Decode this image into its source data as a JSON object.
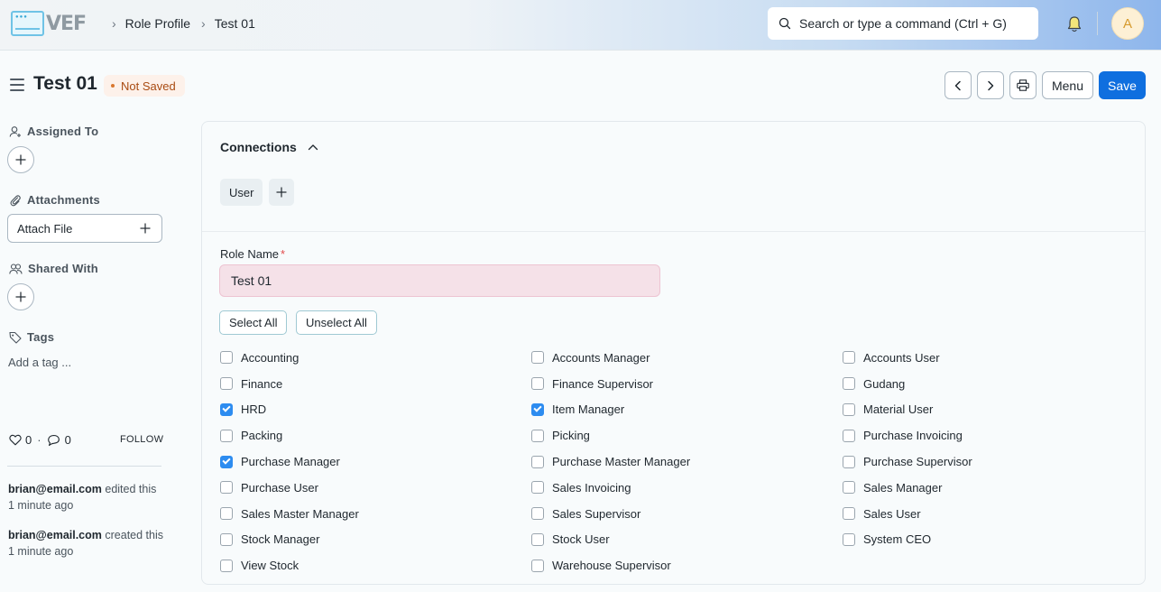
{
  "navbar": {
    "logo_text": "VEF",
    "breadcrumbs": [
      "Role Profile",
      "Test 01"
    ],
    "search_placeholder": "Search or type a command (Ctrl + G)",
    "avatar_initial": "A"
  },
  "header": {
    "title": "Test 01",
    "status": "Not Saved",
    "menu_label": "Menu",
    "save_label": "Save"
  },
  "sidebar": {
    "assigned_to": "Assigned To",
    "attachments": "Attachments",
    "attach_file": "Attach File",
    "shared_with": "Shared With",
    "tags": "Tags",
    "add_tag": "Add a tag ...",
    "likes": "0",
    "comments": "0",
    "follow": "FOLLOW",
    "activity": [
      {
        "user": "brian@email.com",
        "action": "edited this",
        "time": "1 minute ago"
      },
      {
        "user": "brian@email.com",
        "action": "created this",
        "time": "1 minute ago"
      }
    ]
  },
  "connections": {
    "title": "Connections",
    "chip": "User"
  },
  "form": {
    "role_name_label": "Role Name",
    "required_mark": "*",
    "role_name_value": "Test 01",
    "select_all": "Select All",
    "unselect_all": "Unselect All",
    "roles": [
      {
        "label": "Accounting",
        "checked": false
      },
      {
        "label": "Accounts Manager",
        "checked": false
      },
      {
        "label": "Accounts User",
        "checked": false
      },
      {
        "label": "Finance",
        "checked": false
      },
      {
        "label": "Finance Supervisor",
        "checked": false
      },
      {
        "label": "Gudang",
        "checked": false
      },
      {
        "label": "HRD",
        "checked": true
      },
      {
        "label": "Item Manager",
        "checked": true
      },
      {
        "label": "Material User",
        "checked": false
      },
      {
        "label": "Packing",
        "checked": false
      },
      {
        "label": "Picking",
        "checked": false
      },
      {
        "label": "Purchase Invoicing",
        "checked": false
      },
      {
        "label": "Purchase Manager",
        "checked": true
      },
      {
        "label": "Purchase Master Manager",
        "checked": false
      },
      {
        "label": "Purchase Supervisor",
        "checked": false
      },
      {
        "label": "Purchase User",
        "checked": false
      },
      {
        "label": "Sales Invoicing",
        "checked": false
      },
      {
        "label": "Sales Manager",
        "checked": false
      },
      {
        "label": "Sales Master Manager",
        "checked": false
      },
      {
        "label": "Sales Supervisor",
        "checked": false
      },
      {
        "label": "Sales User",
        "checked": false
      },
      {
        "label": "Stock Manager",
        "checked": false
      },
      {
        "label": "Stock User",
        "checked": false
      },
      {
        "label": "System CEO",
        "checked": false
      },
      {
        "label": "View Stock",
        "checked": false
      },
      {
        "label": "Warehouse Supervisor",
        "checked": false
      }
    ]
  }
}
